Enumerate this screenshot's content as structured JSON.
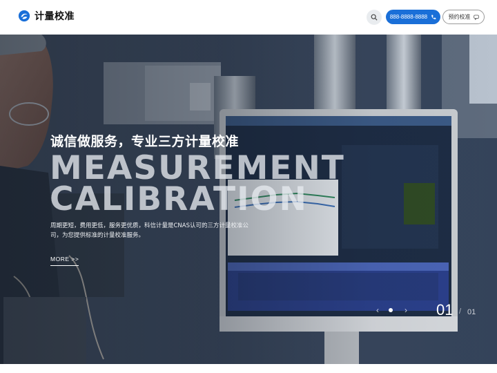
{
  "header": {
    "logo_text": "计量校准",
    "phone_label": "888-8888-8888",
    "book_label": "预约校准"
  },
  "hero": {
    "slogan": "诚信做服务，专业三方计量校准",
    "big_line1": "MEASUREMENT",
    "big_line2": "CALIBRATION",
    "description": "周期更短，费用更低，服务更优质，科信计量是CNAS认可的三方计量校准公司，为您提供标准的计量校准服务。",
    "more_label": "MORE >>",
    "pager": {
      "current": "01",
      "separator": "/",
      "total": "01"
    }
  },
  "icons": {
    "logo": "logo-swirl-icon",
    "search": "search-icon",
    "phone": "phone-icon",
    "book": "chat-bubble-icon",
    "prev": "chevron-left-icon",
    "next": "chevron-right-icon"
  },
  "colors": {
    "brand": "#1a6fd8",
    "header_bg": "#ffffff"
  }
}
